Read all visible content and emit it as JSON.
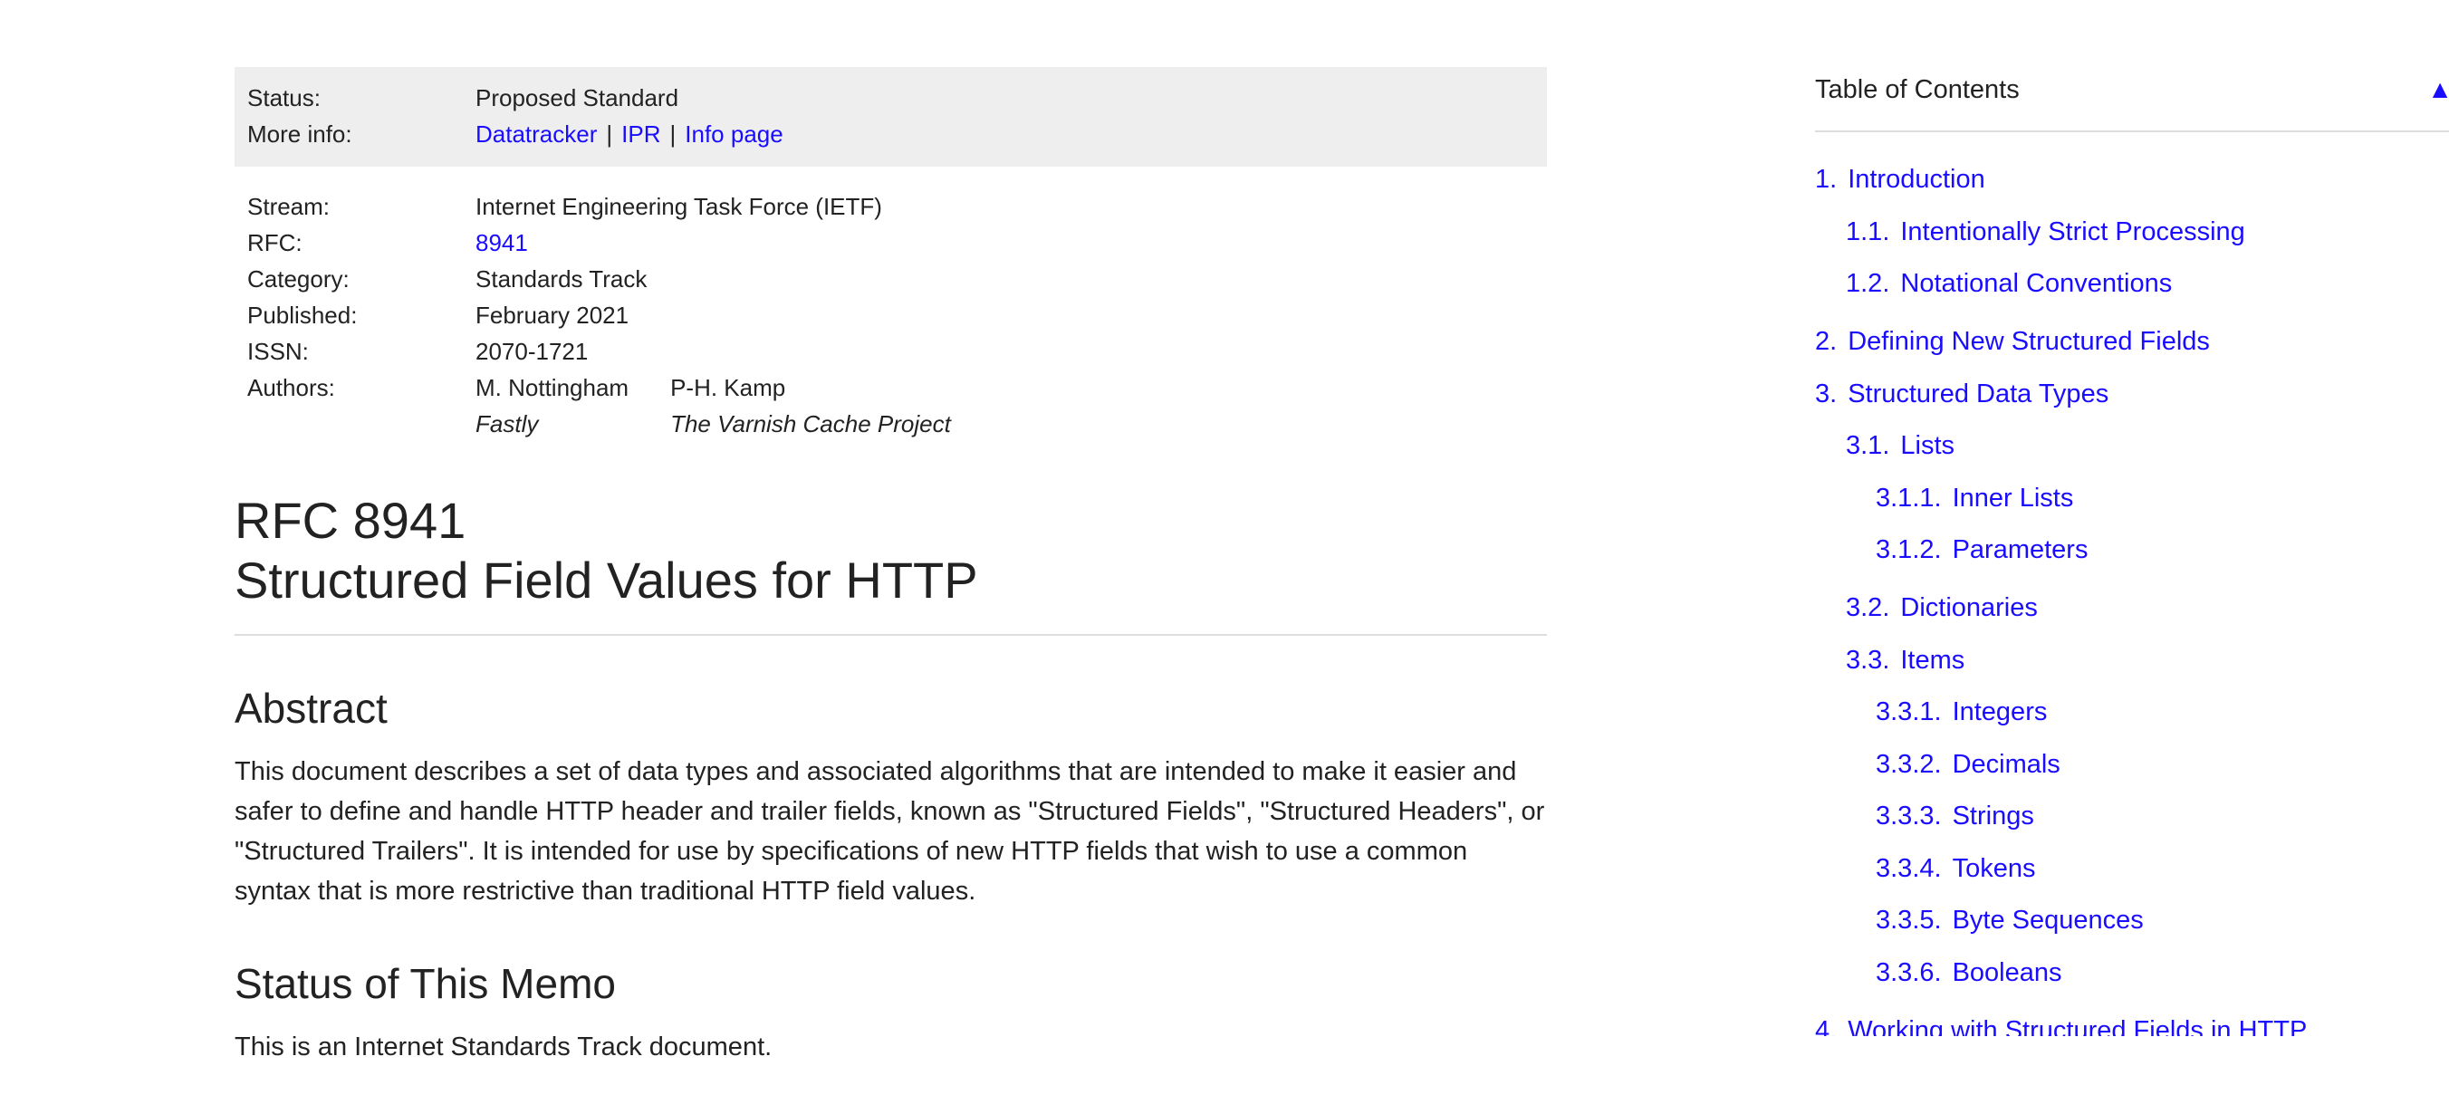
{
  "status_box": {
    "status_label": "Status:",
    "status_value": "Proposed Standard",
    "more_info_label": "More info:",
    "links": [
      "Datatracker",
      "IPR",
      "Info page"
    ],
    "separator": "|"
  },
  "meta": {
    "stream_label": "Stream:",
    "stream_value": "Internet Engineering Task Force (IETF)",
    "rfc_label": "RFC:",
    "rfc_value": "8941",
    "category_label": "Category:",
    "category_value": "Standards Track",
    "published_label": "Published:",
    "published_value": "February 2021",
    "issn_label": "ISSN:",
    "issn_value": "2070-1721",
    "authors_label": "Authors:",
    "authors": [
      {
        "name": "M. Nottingham",
        "org": "Fastly"
      },
      {
        "name": "P-H. Kamp",
        "org": "The Varnish Cache Project"
      }
    ]
  },
  "title": {
    "line1": "RFC 8941",
    "line2": "Structured Field Values for HTTP"
  },
  "abstract": {
    "heading": "Abstract",
    "text": "This document describes a set of data types and associated algorithms that are intended to make it easier and safer to define and handle HTTP header and trailer fields, known as \"Structured Fields\", \"Structured Headers\", or \"Structured Trailers\". It is intended for use by specifications of new HTTP fields that wish to use a common syntax that is more restrictive than traditional HTTP field values."
  },
  "status_memo": {
    "heading": "Status of This Memo",
    "text": "This is an Internet Standards Track document."
  },
  "toc": {
    "heading": "Table of Contents",
    "toggle_icon": "triangle-up-icon",
    "items": [
      {
        "num": "1.",
        "label": "Introduction"
      },
      {
        "num": "1.1.",
        "label": "Intentionally Strict Processing"
      },
      {
        "num": "1.2.",
        "label": "Notational Conventions"
      },
      {
        "num": "2.",
        "label": "Defining New Structured Fields"
      },
      {
        "num": "3.",
        "label": "Structured Data Types"
      },
      {
        "num": "3.1.",
        "label": "Lists"
      },
      {
        "num": "3.1.1.",
        "label": "Inner Lists"
      },
      {
        "num": "3.1.2.",
        "label": "Parameters"
      },
      {
        "num": "3.2.",
        "label": "Dictionaries"
      },
      {
        "num": "3.3.",
        "label": "Items"
      },
      {
        "num": "3.3.1.",
        "label": "Integers"
      },
      {
        "num": "3.3.2.",
        "label": "Decimals"
      },
      {
        "num": "3.3.3.",
        "label": "Strings"
      },
      {
        "num": "3.3.4.",
        "label": "Tokens"
      },
      {
        "num": "3.3.5.",
        "label": "Byte Sequences"
      },
      {
        "num": "3.3.6.",
        "label": "Booleans"
      },
      {
        "num": "4.",
        "label": "Working with Structured Fields in HTTP"
      }
    ]
  },
  "colors": {
    "link": "#1a0dff",
    "status_box_bg": "#eeeeee",
    "text": "#222222"
  }
}
